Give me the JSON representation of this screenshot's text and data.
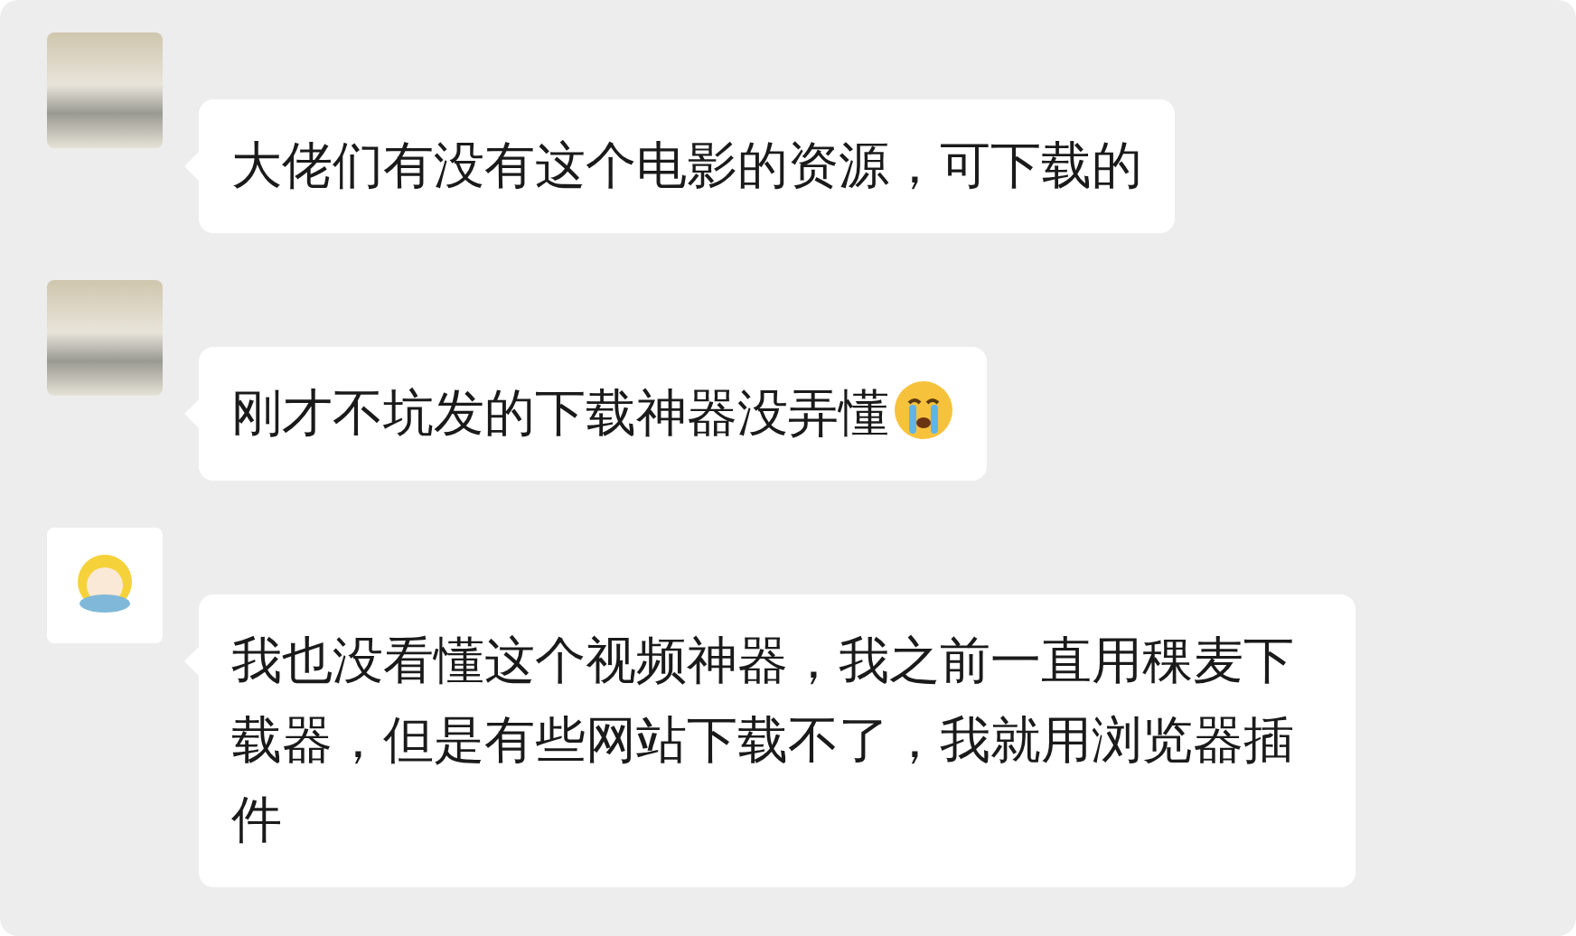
{
  "messages": [
    {
      "text": "大佬们有没有这个电影的资源，可下载的",
      "emoji": false
    },
    {
      "text": "刚才不坑发的下载神器没弄懂",
      "emoji": true
    },
    {
      "text": "我也没看懂这个视频神器，我之前一直用稞麦下载器，但是有些网站下载不了，我就用浏览器插件",
      "emoji": false
    }
  ]
}
